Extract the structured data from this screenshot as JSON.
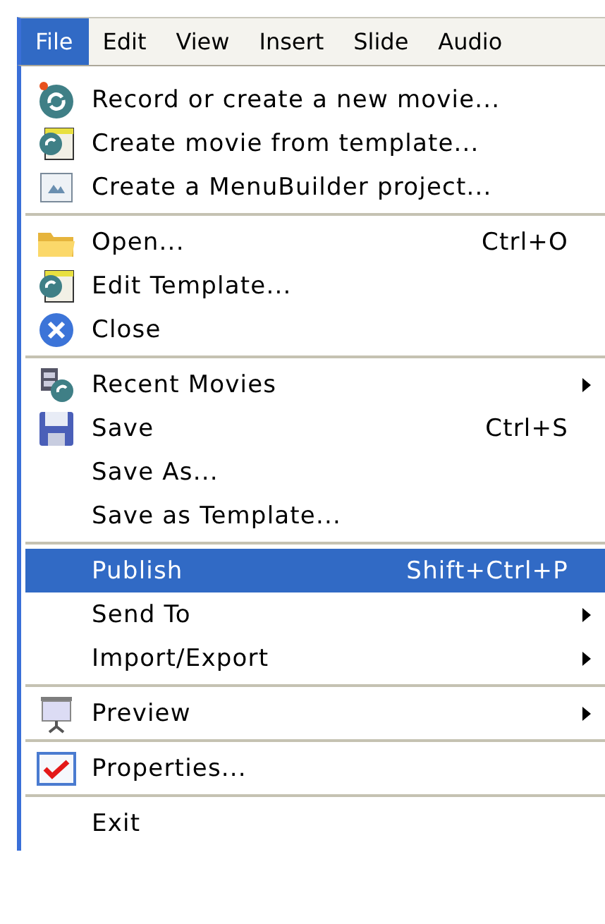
{
  "menu_bar": [
    {
      "label": "File",
      "selected": true
    },
    {
      "label": "Edit",
      "selected": false
    },
    {
      "label": "View",
      "selected": false
    },
    {
      "label": "Insert",
      "selected": false
    },
    {
      "label": "Slide",
      "selected": false
    },
    {
      "label": "Audio",
      "selected": false
    }
  ],
  "menu_groups": [
    [
      {
        "kind": "record",
        "label": "Record or create a new movie...",
        "submenu": false,
        "selected": false
      },
      {
        "kind": "template",
        "label": "Create movie from template...",
        "submenu": false,
        "selected": false
      },
      {
        "kind": "menubuilder",
        "label": "Create a MenuBuilder project...",
        "submenu": false,
        "selected": false
      }
    ],
    [
      {
        "kind": "folder",
        "label": "Open...",
        "shortcut": "Ctrl+O",
        "submenu": false,
        "selected": false
      },
      {
        "kind": "template",
        "label": "Edit Template...",
        "submenu": false,
        "selected": false
      },
      {
        "kind": "close",
        "label": "Close",
        "submenu": false,
        "selected": false
      }
    ],
    [
      {
        "kind": "recent",
        "label": "Recent Movies",
        "submenu": true,
        "selected": false
      },
      {
        "kind": "save",
        "label": "Save",
        "shortcut": "Ctrl+S",
        "submenu": false,
        "selected": false
      },
      {
        "kind": "plain",
        "label": "Save As...",
        "submenu": false,
        "selected": false
      },
      {
        "kind": "plain",
        "label": "Save as Template...",
        "submenu": false,
        "selected": false
      }
    ],
    [
      {
        "kind": "plain",
        "label": "Publish",
        "shortcut": "Shift+Ctrl+P",
        "submenu": false,
        "selected": true
      },
      {
        "kind": "plain",
        "label": "Send To",
        "submenu": true,
        "selected": false
      },
      {
        "kind": "plain",
        "label": "Import/Export",
        "submenu": true,
        "selected": false
      }
    ],
    [
      {
        "kind": "preview",
        "label": "Preview",
        "submenu": true,
        "selected": false
      }
    ],
    [
      {
        "kind": "properties",
        "label": "Properties...",
        "submenu": false,
        "selected": false
      }
    ],
    [
      {
        "kind": "plain",
        "label": "Exit",
        "submenu": false,
        "selected": false
      }
    ]
  ]
}
